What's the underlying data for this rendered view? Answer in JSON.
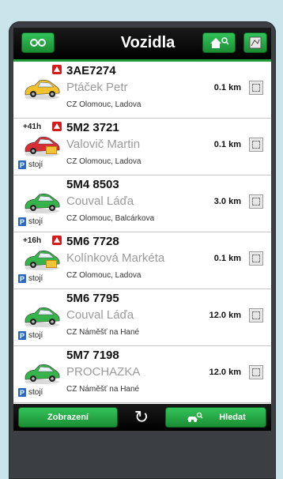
{
  "header": {
    "title": "Vozidla",
    "left_icon": "filter-icon",
    "home_icon": "home-search-icon",
    "map_icon": "map-icon"
  },
  "vehicles": [
    {
      "time": "",
      "warning": true,
      "plate": "3AE7274",
      "driver": "Ptáček Petr",
      "location": "CZ Olomouc, Ladova",
      "distance": "0.1 km",
      "status": "",
      "car_color": "#f2c12e",
      "mail": false
    },
    {
      "time": "+41h",
      "warning": true,
      "plate": "5M2 3721",
      "driver": "Valovič Martin",
      "location": "CZ Olomouc, Ladova",
      "distance": "0.1 km",
      "status": "stojí",
      "car_color": "#d62f35",
      "mail": true
    },
    {
      "time": "",
      "warning": false,
      "plate": "5M4 8503",
      "driver": "Couval Láďa",
      "location": "CZ Olomouc, Balcárkova",
      "distance": "3.0 km",
      "status": "stojí",
      "car_color": "#36b34a",
      "mail": false
    },
    {
      "time": "+16h",
      "warning": true,
      "plate": "5M6 7728",
      "driver": "Kolínková Markéta",
      "location": "CZ Olomouc, Ladova",
      "distance": "0.1 km",
      "status": "stojí",
      "car_color": "#36b34a",
      "mail": true
    },
    {
      "time": "",
      "warning": false,
      "plate": "5M6 7795",
      "driver": "Couval Láďa",
      "location": "CZ Náměšť na Hané",
      "distance": "12.0 km",
      "status": "stojí",
      "car_color": "#36b34a",
      "mail": false
    },
    {
      "time": "",
      "warning": false,
      "plate": "5M7 7198",
      "driver": "PROCHAZKA",
      "location": "CZ Náměšť na Hané",
      "distance": "12.0 km",
      "status": "stojí",
      "car_color": "#36b34a",
      "mail": false
    }
  ],
  "bottom": {
    "left_label": "Zobrazení",
    "refresh_icon": "refresh-icon",
    "right_label": "Hledat",
    "right_icon": "car-search-icon"
  },
  "colors": {
    "accent": "#1f9b3a",
    "header_bg": "#000000"
  }
}
